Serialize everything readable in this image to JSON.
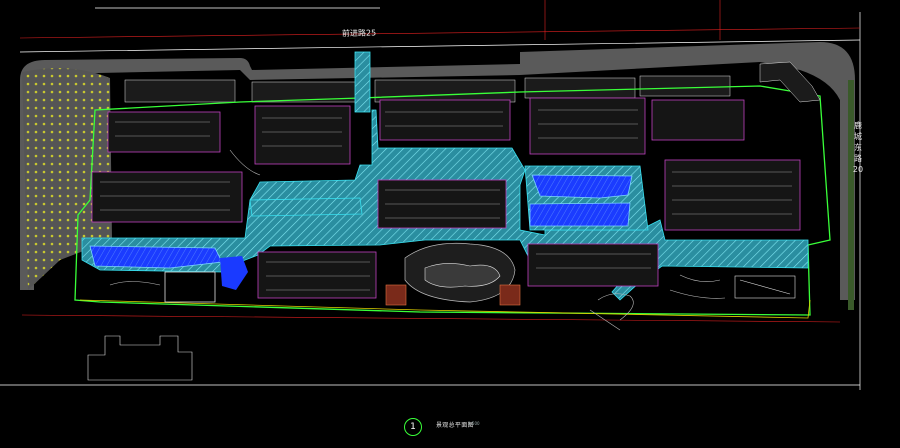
{
  "labels": {
    "road_top": "前进路25",
    "road_right_lines": [
      "鹿",
      "城",
      "东",
      "路",
      "20"
    ],
    "plan_number": "1",
    "plan_title": "景观总平面图",
    "plan_scale": "1:500"
  },
  "colors": {
    "background": "#000000",
    "road_gray": "#5a5a5a",
    "building_dark": "#1a1a1a",
    "building_outline": "#c040c0",
    "plaza_cyan": "#39c4d4",
    "water_blue": "#1a3aff",
    "lawn_green": "#2a6a2a",
    "boundary_red": "#e02020",
    "line_green": "#39ff39",
    "line_yellow": "#e0d000"
  },
  "icons": [
    "north-circle-icon"
  ]
}
